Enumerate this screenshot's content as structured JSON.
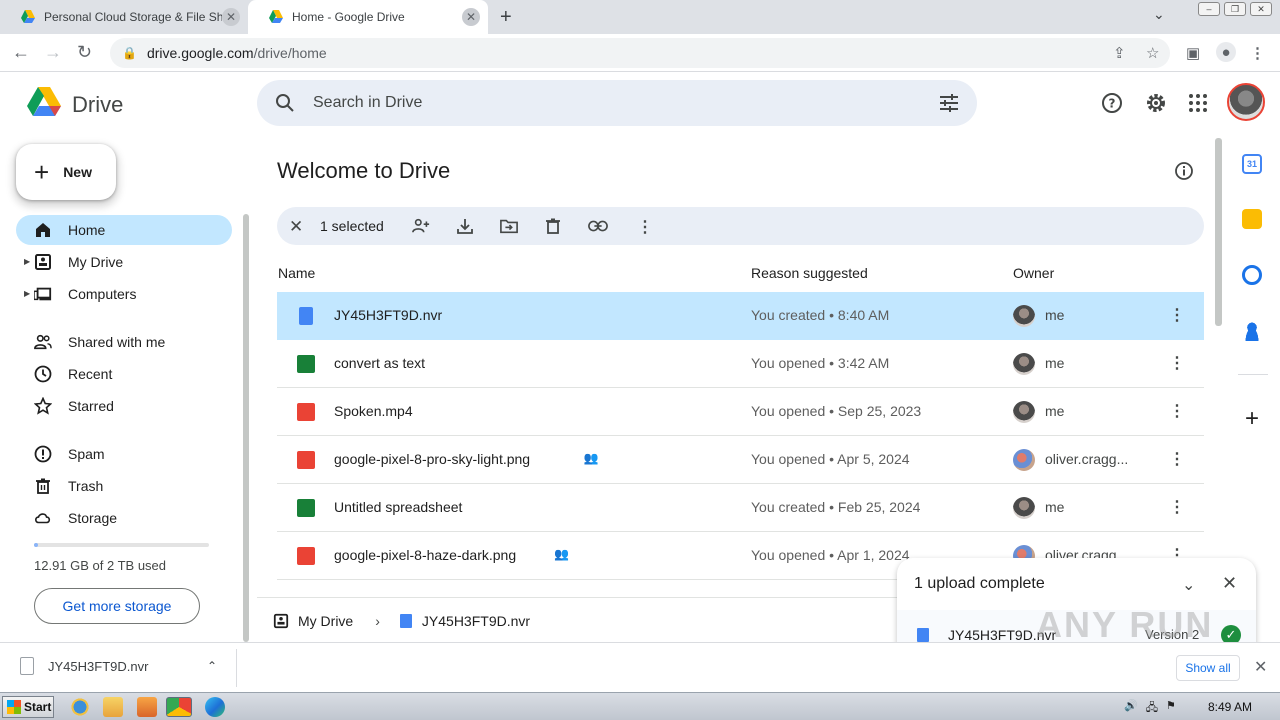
{
  "browser": {
    "tabs": [
      {
        "title": "Personal Cloud Storage & File Sharin",
        "active": false
      },
      {
        "title": "Home - Google Drive",
        "active": true
      }
    ],
    "url_domain": "drive.google.com",
    "url_path": "/drive/home"
  },
  "header": {
    "brand": "Drive",
    "search_placeholder": "Search in Drive"
  },
  "sidebar": {
    "new_label": "New",
    "items": [
      {
        "label": "Home",
        "icon": "home-icon",
        "active": true
      },
      {
        "label": "My Drive",
        "icon": "my-drive-icon",
        "expandable": true
      },
      {
        "label": "Computers",
        "icon": "computers-icon",
        "expandable": true
      },
      {
        "label": "Shared with me",
        "icon": "shared-icon"
      },
      {
        "label": "Recent",
        "icon": "clock-icon"
      },
      {
        "label": "Starred",
        "icon": "star-icon"
      },
      {
        "label": "Spam",
        "icon": "spam-icon"
      },
      {
        "label": "Trash",
        "icon": "trash-icon"
      },
      {
        "label": "Storage",
        "icon": "cloud-icon"
      }
    ],
    "storage_used_fraction": 0.0063,
    "storage_text": "12.91 GB of 2 TB used",
    "get_storage_label": "Get more storage"
  },
  "main": {
    "title": "Welcome to Drive",
    "selection": {
      "text": "1 selected"
    },
    "columns": {
      "name": "Name",
      "reason": "Reason suggested",
      "owner": "Owner"
    },
    "files": [
      {
        "name": "JY45H3FT9D.nvr",
        "type": "doc",
        "reason": "You created • 8:40 AM",
        "owner": "me",
        "selected": true,
        "shared": false
      },
      {
        "name": "convert as text",
        "type": "sheet",
        "reason": "You opened • 3:42 AM",
        "owner": "me",
        "selected": false,
        "shared": false
      },
      {
        "name": "Spoken.mp4",
        "type": "video",
        "reason": "You opened • Sep 25, 2023",
        "owner": "me",
        "selected": false,
        "shared": false
      },
      {
        "name": "google-pixel-8-pro-sky-light.png",
        "type": "image",
        "reason": "You opened • Apr 5, 2024",
        "owner": "oliver.cragg...",
        "selected": false,
        "shared": true
      },
      {
        "name": "Untitled spreadsheet",
        "type": "sheet",
        "reason": "You created • Feb 25, 2024",
        "owner": "me",
        "selected": false,
        "shared": false
      },
      {
        "name": "google-pixel-8-haze-dark.png",
        "type": "image",
        "reason": "You opened • Apr 1, 2024",
        "owner": "oliver.cragg...",
        "selected": false,
        "shared": true
      }
    ],
    "breadcrumb": {
      "root": "My Drive",
      "file": "JY45H3FT9D.nvr"
    }
  },
  "upload_panel": {
    "title": "1 upload complete",
    "file": "JY45H3FT9D.nvr",
    "version": "Version 2"
  },
  "download_bar": {
    "file": "JY45H3FT9D.nvr",
    "show_all": "Show all"
  },
  "taskbar": {
    "start": "Start",
    "clock": "8:49 AM"
  },
  "watermark": "ANY RUN",
  "colors": {
    "accent": "#0b57d0",
    "selected_row": "#c2e7ff",
    "search_bg": "#e9eef6",
    "doc_blue": "#4285f4",
    "sheet_green": "#188038",
    "red": "#ea4335"
  }
}
